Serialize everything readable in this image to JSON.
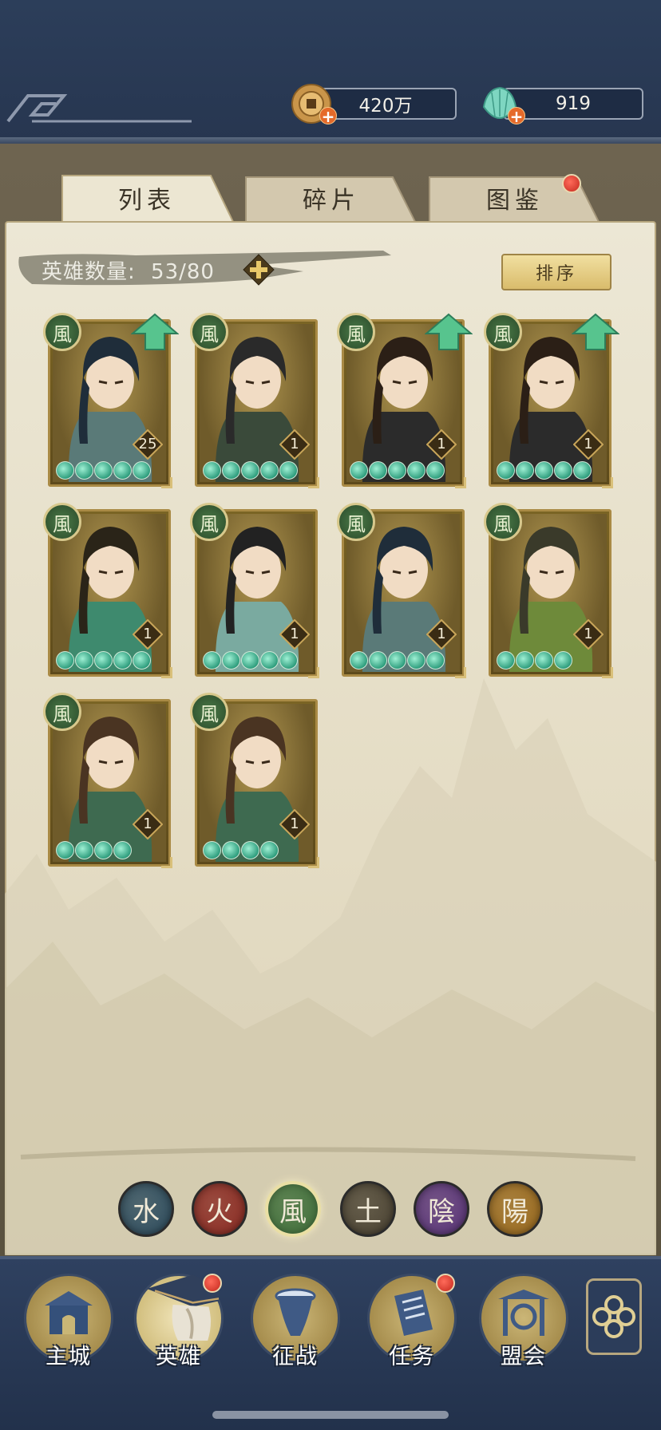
{
  "currency": {
    "gold": "420万",
    "jade": "919"
  },
  "tabs": [
    {
      "label": "列表"
    },
    {
      "label": "碎片"
    },
    {
      "label": "图鉴"
    }
  ],
  "hero_count": {
    "label": "英雄数量:",
    "value": "53/80"
  },
  "sort_label": "排序",
  "heroes": [
    {
      "element": "風",
      "level": "25",
      "stars": 5,
      "upgrade": true
    },
    {
      "element": "風",
      "level": "1",
      "stars": 5,
      "upgrade": false
    },
    {
      "element": "風",
      "level": "1",
      "stars": 5,
      "upgrade": true
    },
    {
      "element": "風",
      "level": "1",
      "stars": 5,
      "upgrade": true
    },
    {
      "element": "風",
      "level": "1",
      "stars": 5,
      "upgrade": false
    },
    {
      "element": "風",
      "level": "1",
      "stars": 5,
      "upgrade": false
    },
    {
      "element": "風",
      "level": "1",
      "stars": 5,
      "upgrade": false
    },
    {
      "element": "風",
      "level": "1",
      "stars": 4,
      "upgrade": false
    },
    {
      "element": "風",
      "level": "1",
      "stars": 4,
      "upgrade": false
    },
    {
      "element": "風",
      "level": "1",
      "stars": 4,
      "upgrade": false
    }
  ],
  "filters": [
    {
      "glyph": "水",
      "color": "#2d4c5e"
    },
    {
      "glyph": "火",
      "color": "#8a2a22"
    },
    {
      "glyph": "風",
      "color": "#3f6f3a"
    },
    {
      "glyph": "土",
      "color": "#4a4232"
    },
    {
      "glyph": "陰",
      "color": "#5a3479"
    },
    {
      "glyph": "陽",
      "color": "#9a6a1e"
    }
  ],
  "nav": [
    {
      "label": "主城",
      "icon": "city-gate-icon"
    },
    {
      "label": "英雄",
      "icon": "hero-portrait-icon"
    },
    {
      "label": "征战",
      "icon": "battle-horn-icon"
    },
    {
      "label": "任务",
      "icon": "scroll-task-icon"
    },
    {
      "label": "盟会",
      "icon": "alliance-gate-icon"
    }
  ],
  "colors": {
    "accent_gold": "#d9bc6c",
    "header_blue": "#2c3e5a",
    "notification_red": "#c4281d",
    "star_jade": "#2f9e7e"
  }
}
